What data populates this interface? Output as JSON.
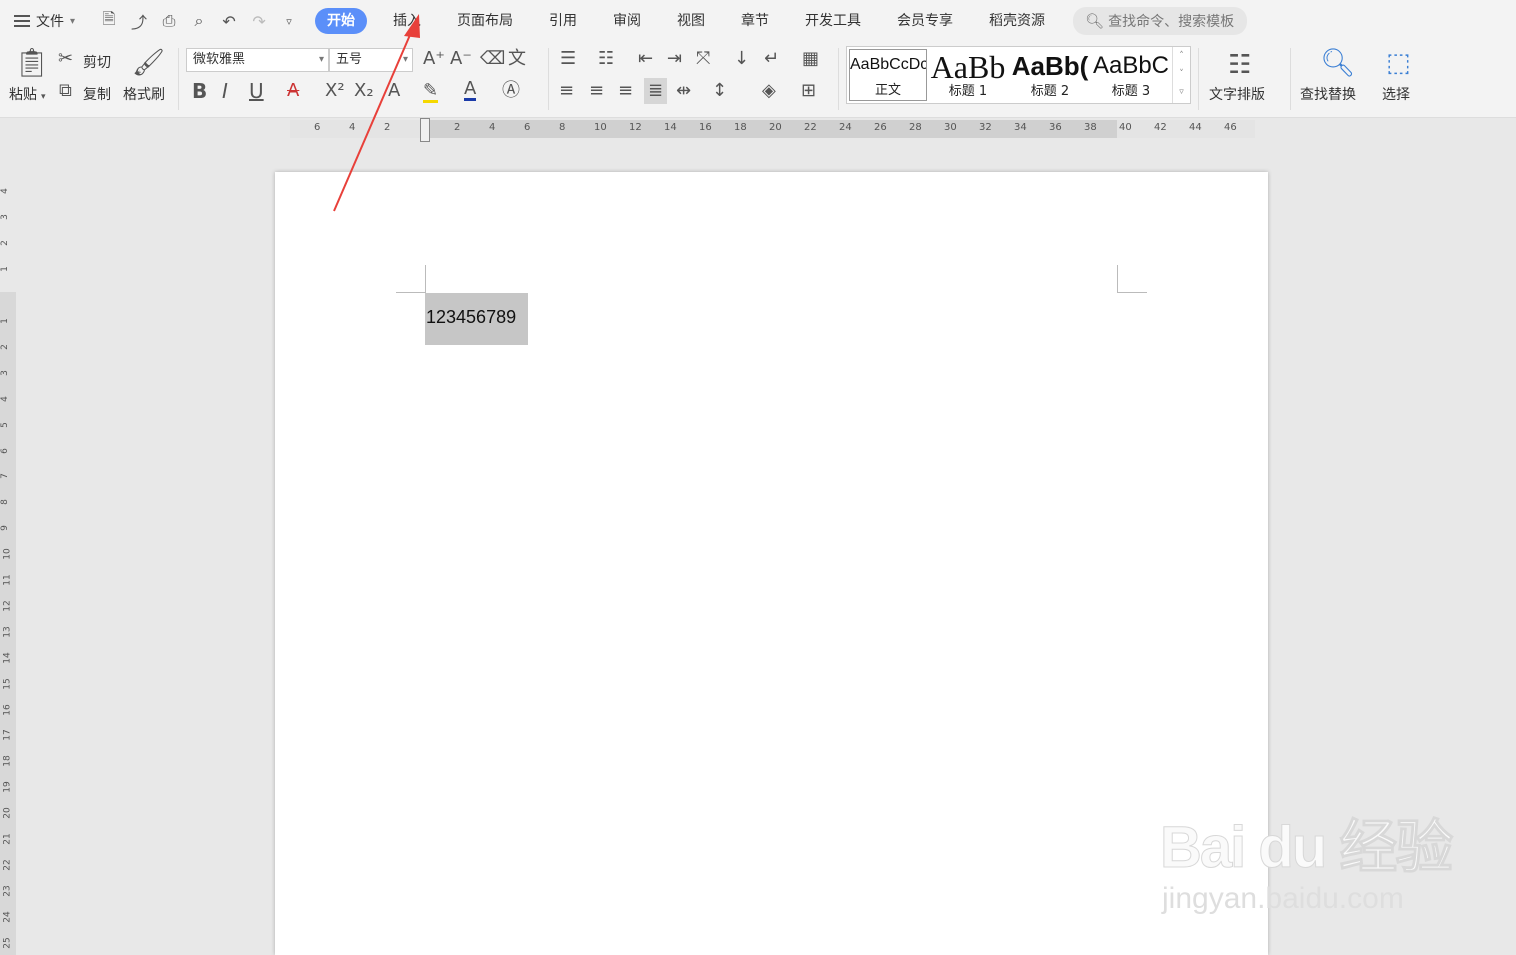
{
  "menubar": {
    "file": "文件",
    "tabs": [
      {
        "label": "开始",
        "active": true
      },
      {
        "label": "插入"
      },
      {
        "label": "页面布局"
      },
      {
        "label": "引用"
      },
      {
        "label": "审阅"
      },
      {
        "label": "视图"
      },
      {
        "label": "章节"
      },
      {
        "label": "开发工具"
      },
      {
        "label": "会员专享"
      },
      {
        "label": "稻壳资源"
      }
    ],
    "search_placeholder": "查找命令、搜索模板"
  },
  "toolbar": {
    "paste": "粘贴",
    "cut": "剪切",
    "copy": "复制",
    "format_painter": "格式刷",
    "font_name": "微软雅黑",
    "font_size": "五号",
    "styles": [
      {
        "preview": "AaBbCcDc",
        "name": "正文"
      },
      {
        "preview": "AaBb",
        "name": "标题 1"
      },
      {
        "preview": "AaBb(",
        "name": "标题 2"
      },
      {
        "preview": "AaBbC",
        "name": "标题 3"
      }
    ],
    "text_layout": "文字排版",
    "find_replace": "查找替换",
    "select": "选择"
  },
  "ruler": {
    "h_ticks": [
      "6",
      "4",
      "2",
      "2",
      "4",
      "6",
      "8",
      "10",
      "12",
      "14",
      "16",
      "18",
      "20",
      "22",
      "24",
      "26",
      "28",
      "30",
      "32",
      "34",
      "36",
      "38",
      "40",
      "42",
      "44",
      "46"
    ],
    "v_ticks": [
      "4",
      "3",
      "2",
      "1",
      "1",
      "2",
      "3",
      "4",
      "5",
      "6",
      "7",
      "8",
      "9",
      "10",
      "11",
      "12",
      "13",
      "14",
      "15",
      "16",
      "17",
      "18",
      "19",
      "20",
      "21",
      "22",
      "23",
      "24",
      "25"
    ]
  },
  "document": {
    "text": "123456789"
  },
  "watermark": {
    "brand": "Bai du 经验",
    "url": "jingyan.baidu.com"
  },
  "colors": {
    "accent": "#5b8ff9",
    "annotation_arrow": "#e8403a",
    "selection": "#c6c6c6"
  }
}
